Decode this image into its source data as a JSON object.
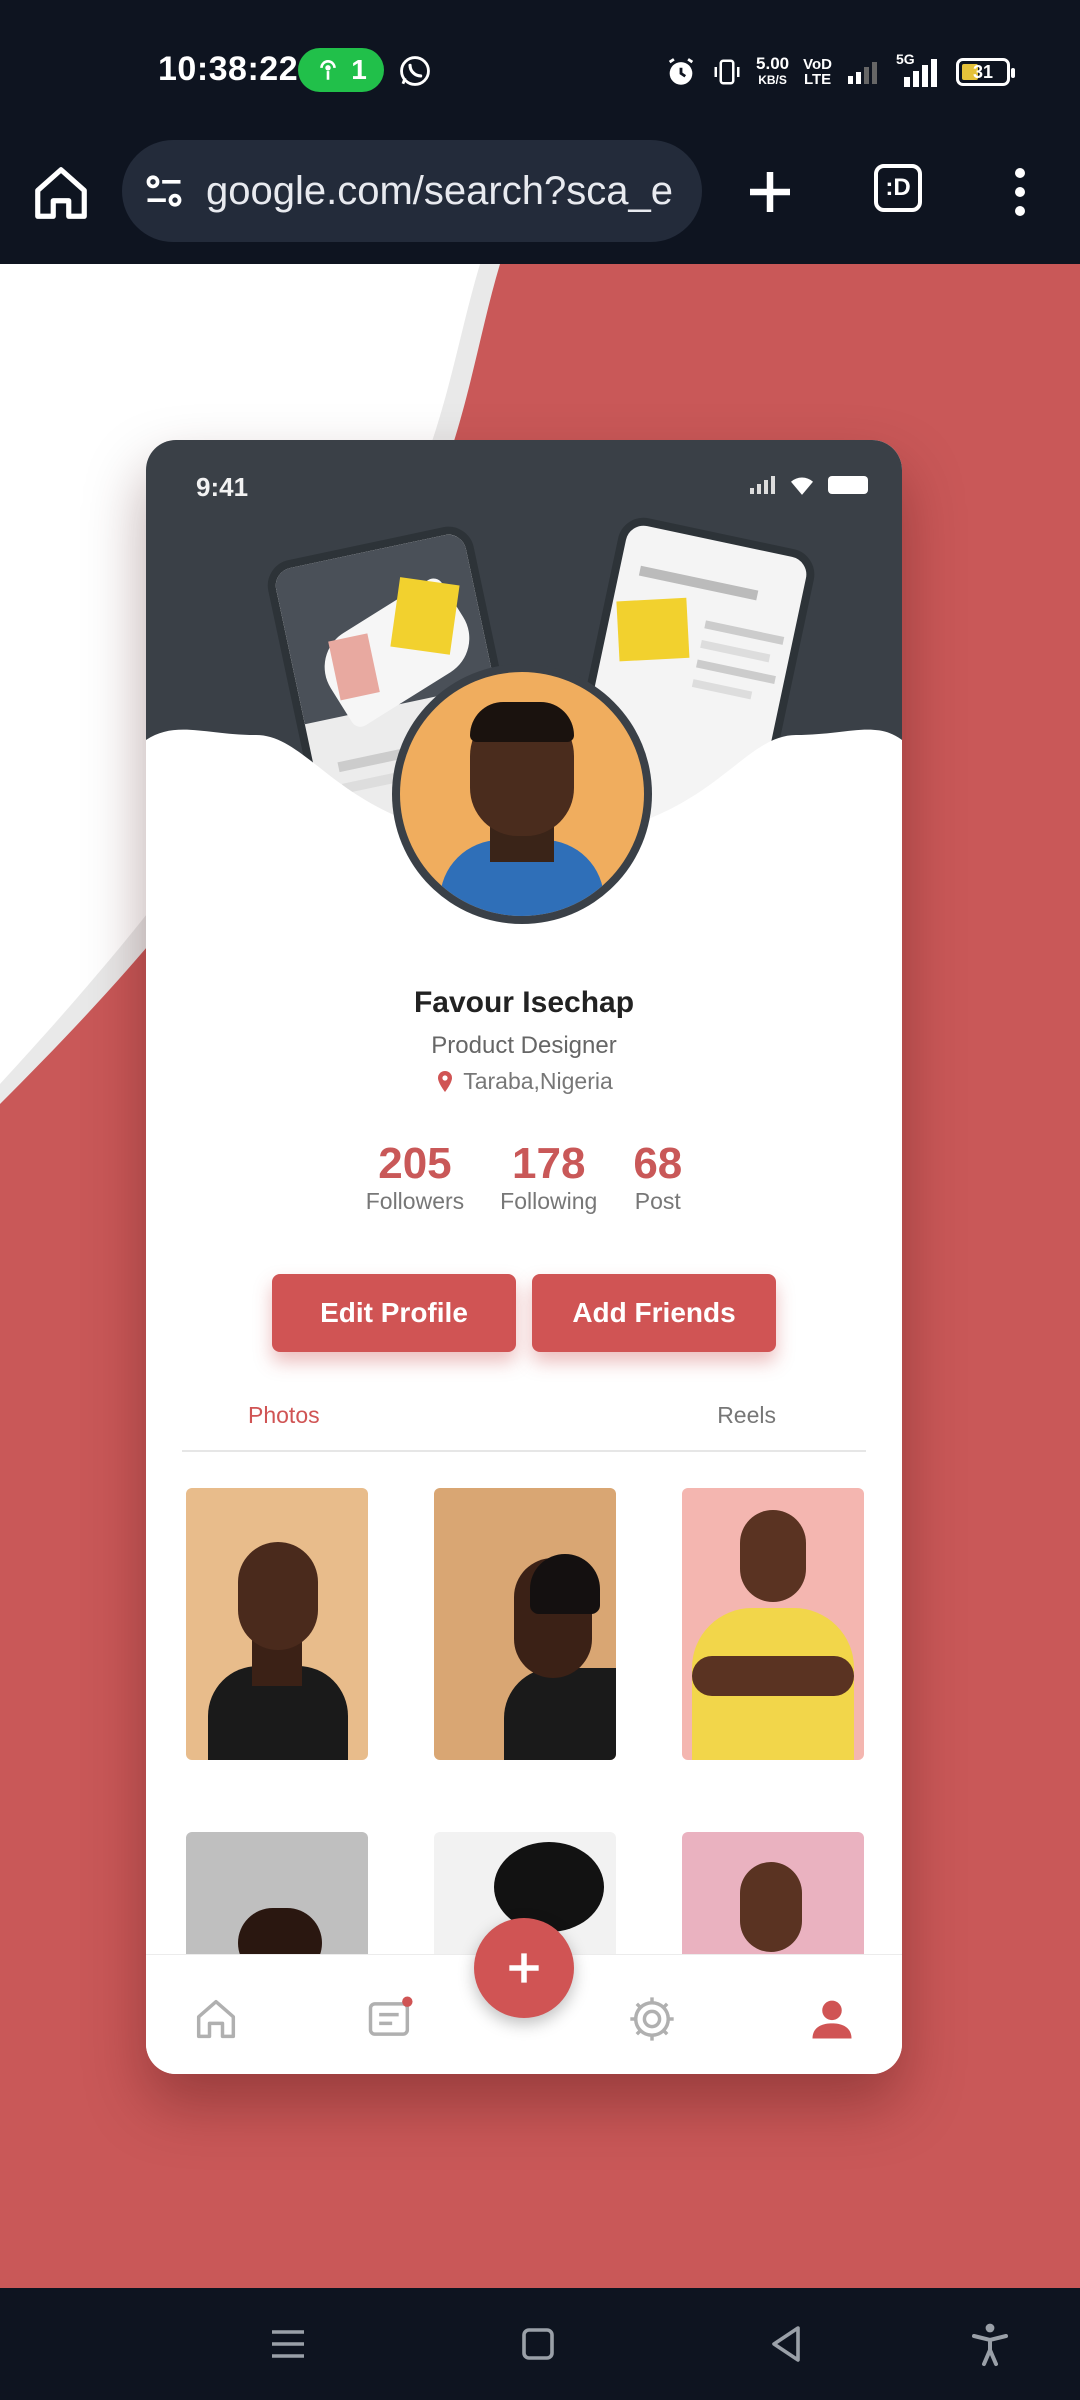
{
  "status_bar": {
    "time": "10:38:22",
    "hotspot_count": "1",
    "net_speed_value": "5.00",
    "net_speed_unit": "KB/S",
    "volte_top": "VoD",
    "volte_bottom": "LTE",
    "network_label": "5G",
    "battery": "31"
  },
  "browser": {
    "url": "google.com/search?sca_e",
    "tabs_label": ":D"
  },
  "profile": {
    "status_time": "9:41",
    "name": "Favour Isechap",
    "role": "Product Designer",
    "location": "Taraba,Nigeria",
    "stats": [
      {
        "value": "205",
        "label": "Followers"
      },
      {
        "value": "178",
        "label": "Following"
      },
      {
        "value": "68",
        "label": "Post"
      }
    ],
    "buttons": {
      "edit": "Edit Profile",
      "add": "Add Friends"
    },
    "tabs": {
      "photos": "Photos",
      "reels": "Reels"
    }
  },
  "colors": {
    "accent": "#d05454",
    "background_red": "#c95858",
    "header_dark": "#3a4047",
    "system_bar": "#0e1420"
  }
}
